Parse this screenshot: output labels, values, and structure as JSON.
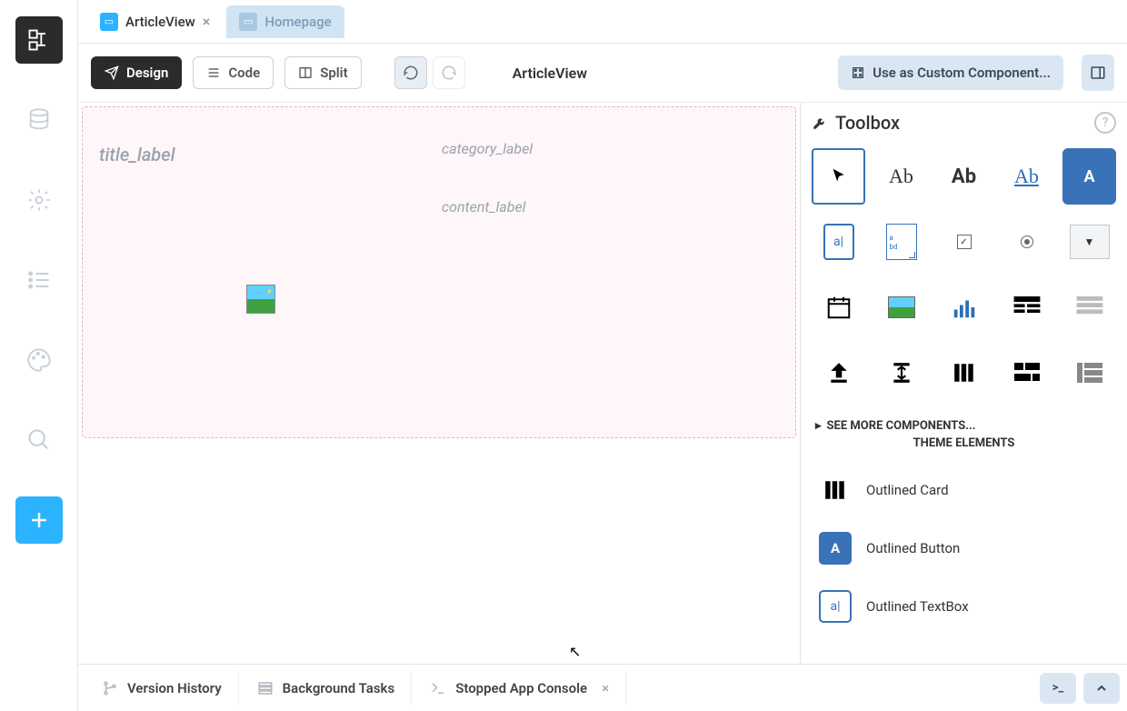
{
  "tabs": {
    "active": "ArticleView",
    "inactive": "Homepage",
    "close": "×"
  },
  "toolbar": {
    "design": "Design",
    "code": "Code",
    "split": "Split",
    "component_name": "ArticleView",
    "use_custom": "Use as Custom Component..."
  },
  "canvas": {
    "title_label": "title_label",
    "category_label": "category_label",
    "content_label": "content_label"
  },
  "toolbox": {
    "header": "Toolbox",
    "label_plain": "Ab",
    "label_bold": "Ab",
    "label_link": "Ab",
    "button_glyph": "A",
    "textbox_glyph": "a|",
    "textarea_line1": "a",
    "textarea_line2": "bd",
    "checkbox_mark": "✓",
    "dropdown_caret": "▼",
    "see_more": "SEE MORE COMPONENTS...",
    "theme_header": "THEME ELEMENTS",
    "theme_card": "Outlined Card",
    "theme_button": "Outlined Button",
    "theme_textbox": "Outlined TextBox"
  },
  "bottom": {
    "version_history": "Version History",
    "background_tasks": "Background Tasks",
    "console": "Stopped App Console",
    "console_close": "×",
    "terminal_glyph": ">_"
  }
}
